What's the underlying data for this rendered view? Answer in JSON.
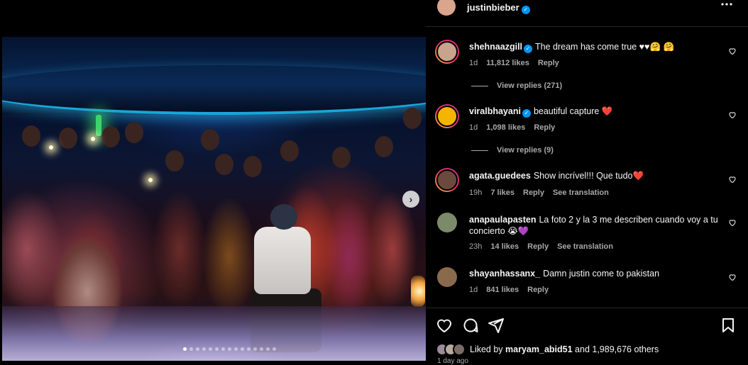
{
  "post": {
    "username": "justinbieber",
    "more_icon": "more-horizontal-icon",
    "likes_prefix": "Liked by",
    "liked_by_user": "maryam_abid51",
    "likes_suffix": "and 1,989,676 others",
    "timestamp": "1 day ago",
    "carousel_total": 15,
    "carousel_index": 1
  },
  "comments": [
    {
      "username": "shehnaazgill",
      "verified": true,
      "text": "The dream has come true ♥♥🤗 🤗",
      "age": "1d",
      "likes": "11,812 likes",
      "reply": "Reply",
      "view_replies": "View replies (271)",
      "avatar_color": "#c9a38c"
    },
    {
      "username": "viralbhayani",
      "verified": true,
      "text": "beautiful capture ❤️",
      "age": "1d",
      "likes": "1,098 likes",
      "reply": "Reply",
      "view_replies": "View replies (9)",
      "avatar_color": "#f5b400"
    },
    {
      "username": "agata.guedees",
      "verified": false,
      "text": "Show incrível!!! Que tudo❤️",
      "age": "19h",
      "likes": "7 likes",
      "reply": "Reply",
      "see_translation": "See translation",
      "avatar_color": "#6b4a3d"
    },
    {
      "username": "anapaulapasten",
      "verified": false,
      "text": "La foto 2 y la 3 me describen cuando voy a tu concierto 😭💜",
      "age": "23h",
      "likes": "14 likes",
      "reply": "Reply",
      "see_translation": "See translation",
      "avatar_color": "#7d8a6a"
    },
    {
      "username": "shayanhassanx_",
      "verified": false,
      "text": "Damn justin come to pakistan",
      "age": "1d",
      "likes": "841 likes",
      "reply": "Reply",
      "avatar_color": "#8a6a4d"
    }
  ],
  "icons": {
    "like": "heart-icon",
    "comment": "comment-icon",
    "share": "send-icon",
    "save": "bookmark-icon",
    "next": "chevron-right-icon"
  },
  "colors": {
    "background": "#000000",
    "verified": "#0095f6",
    "secondary_text": "#a8a8a8",
    "divider": "#262626"
  }
}
